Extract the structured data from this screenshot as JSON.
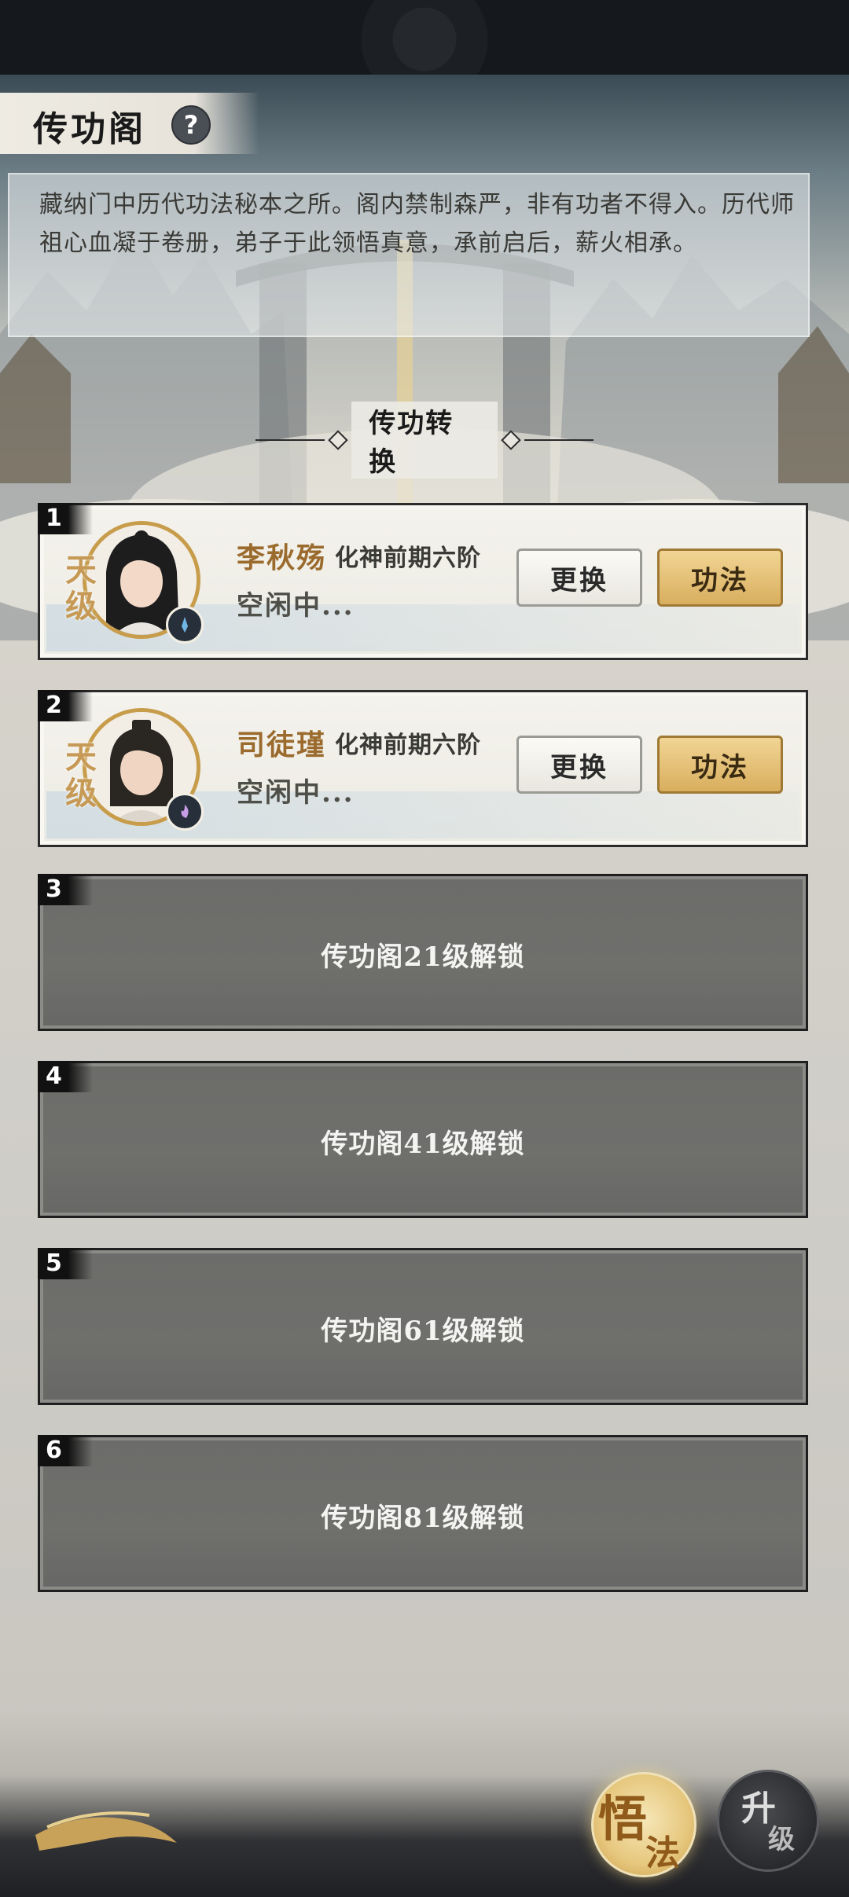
{
  "header": {
    "title": "传功阁",
    "help_icon": "?"
  },
  "description": "藏纳门中历代功法秘本之所。阁内禁制森严，非有功者不得入。历代师祖心血凝于卷册，弟子于此领悟真意，承前启后，薪火相承。",
  "section_title": "传功转换",
  "slots": [
    {
      "num": "1",
      "grade": "天级",
      "name": "李秋殇",
      "rank": "化神前期六阶",
      "status": "空闲中...",
      "change_label": "更换",
      "skill_label": "功法",
      "element_icon": "water-element-icon"
    },
    {
      "num": "2",
      "grade": "天级",
      "name": "司徒瑾",
      "rank": "化神前期六阶",
      "status": "空闲中...",
      "change_label": "更换",
      "skill_label": "功法",
      "element_icon": "spirit-element-icon"
    },
    {
      "num": "3",
      "lock_text": "传功阁21级解锁"
    },
    {
      "num": "4",
      "lock_text": "传功阁41级解锁"
    },
    {
      "num": "5",
      "lock_text": "传功阁61级解锁"
    },
    {
      "num": "6",
      "lock_text": "传功阁81级解锁"
    }
  ],
  "footer": {
    "enlighten_char1": "悟",
    "enlighten_char2": "法",
    "upgrade_char1": "升",
    "upgrade_char2": "级"
  },
  "colors": {
    "accent_gold": "#d9ae5e",
    "name_color": "#9b6b2e",
    "locked_slot": "#6c6c6a"
  }
}
